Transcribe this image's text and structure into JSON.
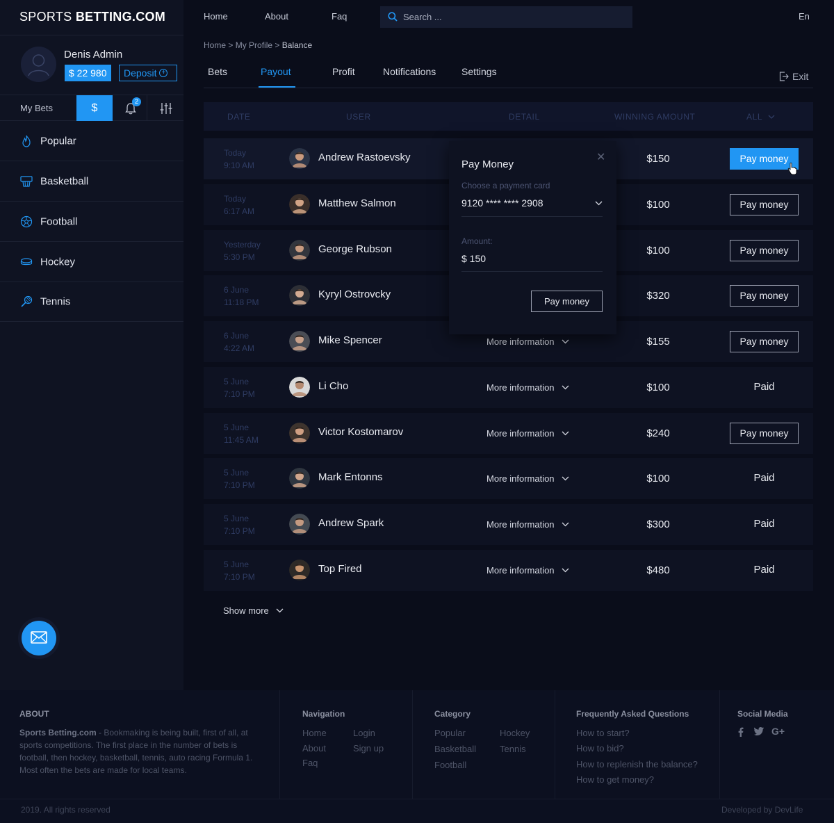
{
  "brand": {
    "part1": "Sports",
    "part2": "Betting.com"
  },
  "topnav": [
    {
      "label": "Home"
    },
    {
      "label": "About"
    },
    {
      "label": "Faq"
    }
  ],
  "search": {
    "placeholder": "Search ..."
  },
  "lang": "En",
  "profile": {
    "name": "Denis Admin",
    "balance": "$ 22 980",
    "deposit_label": "Deposit"
  },
  "side_tabs": {
    "my_bets": "My Bets",
    "dollar": "$",
    "notifications_count": "2"
  },
  "categories": [
    {
      "label": "Popular",
      "icon": "fire-icon"
    },
    {
      "label": "Basketball",
      "icon": "basketball-icon"
    },
    {
      "label": "Football",
      "icon": "football-icon"
    },
    {
      "label": "Hockey",
      "icon": "hockey-puck-icon"
    },
    {
      "label": "Tennis",
      "icon": "tennis-racket-icon"
    }
  ],
  "breadcrumb": {
    "home": "Home",
    "profile": "My Profile",
    "current": "Balance",
    "sep": ">"
  },
  "profile_tabs": [
    {
      "label": "Bets"
    },
    {
      "label": "Payout"
    },
    {
      "label": "Profit"
    },
    {
      "label": "Notifications"
    },
    {
      "label": "Settings"
    }
  ],
  "exit_label": "Exit",
  "table": {
    "headers": {
      "date": "DATE",
      "user": "USER",
      "detail": "DETAIL",
      "amount": "WINNING AMOUNT",
      "filter": "ALL"
    },
    "more_label": "More information",
    "pay_label": "Pay money",
    "rows": [
      {
        "date": "Today",
        "time": "9:10 AM",
        "user": "Andrew Rastoevsky",
        "amount": "$150",
        "status": "Pay money"
      },
      {
        "date": "Today",
        "time": "6:17 AM",
        "user": "Matthew Salmon",
        "amount": "$100",
        "status": "Pay money"
      },
      {
        "date": "Yesterday",
        "time": "5:30 PM",
        "user": "George Rubson",
        "amount": "$100",
        "status": "Pay money"
      },
      {
        "date": "6 June",
        "time": "11:18 PM",
        "user": "Kyryl Ostrovcky",
        "amount": "$320",
        "status": "Pay money"
      },
      {
        "date": "6 June",
        "time": "4:22 AM",
        "user": "Mike Spencer",
        "amount": "$155",
        "status": "Pay money"
      },
      {
        "date": "5 June",
        "time": "7:10 PM",
        "user": "Li Cho",
        "amount": "$100",
        "status": "Paid"
      },
      {
        "date": "5 June",
        "time": "11:45 AM",
        "user": "Victor Kostomarov",
        "amount": "$240",
        "status": "Pay money"
      },
      {
        "date": "5 June",
        "time": "7:10 PM",
        "user": "Mark Entonns",
        "amount": "$100",
        "status": "Paid"
      },
      {
        "date": "5 June",
        "time": "7:10 PM",
        "user": "Andrew Spark",
        "amount": "$300",
        "status": "Paid"
      },
      {
        "date": "5 June",
        "time": "7:10 PM",
        "user": "Top Fired",
        "amount": "$480",
        "status": "Paid"
      }
    ],
    "show_more": "Show more"
  },
  "popup": {
    "title": "Pay Money",
    "card_label": "Choose a payment card",
    "card_value": "9120 **** **** 2908",
    "amount_label": "Amount:",
    "amount_value": "$ 150",
    "button": "Pay money"
  },
  "footer": {
    "about_title": "ABOUT",
    "about_brand": "Sports Betting.com",
    "about_text": " - Bookmaking is being built, first of all, at sports competitions. The first place in the number of bets is football, then hockey, basketball, tennis, auto racing Formula 1. Most often the bets are made for local teams.",
    "nav_title": "Navigation",
    "nav": [
      "Home",
      "About",
      "Faq",
      "Login",
      "Sign up"
    ],
    "cat_title": "Category",
    "cats": [
      "Popular",
      "Basketball",
      "Football",
      "Hockey",
      "Tennis"
    ],
    "faq_title": "Frequently Asked Questions",
    "faqs": [
      "How to start?",
      "How to bid?",
      "How to replenish the balance?",
      "How to get money?"
    ],
    "social_title": "Social Media",
    "copyright": "2019. All rights reserved",
    "developed": "Developed by DevLife"
  },
  "colors": {
    "accent": "#2196f3",
    "background": "#0a0d1a",
    "sidebar": "#0f1322"
  }
}
